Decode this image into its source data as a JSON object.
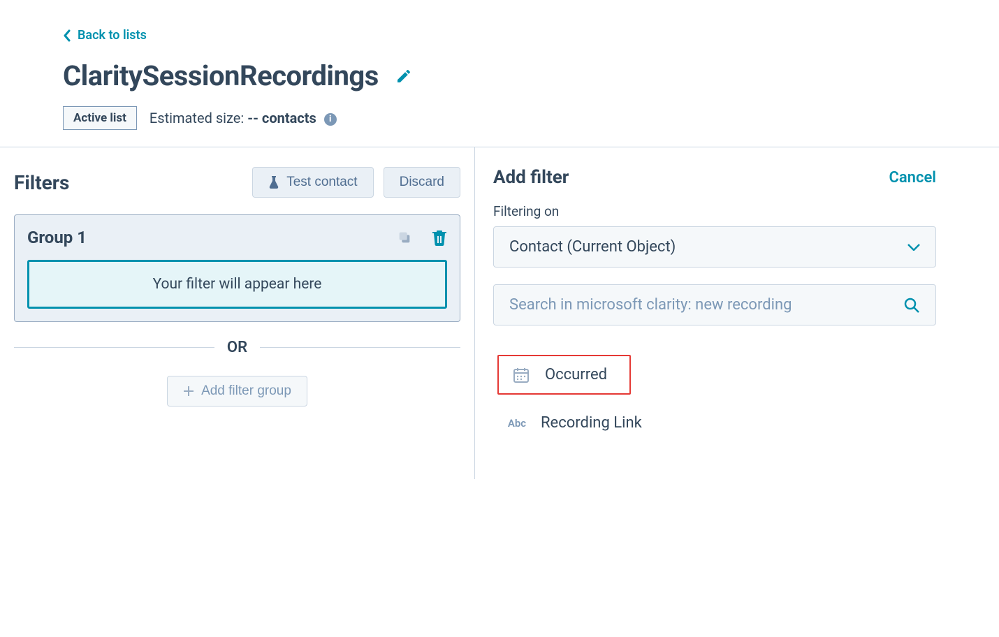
{
  "header": {
    "back_label": "Back to lists",
    "title": "ClaritySessionRecordings",
    "badge_label": "Active list",
    "estimated_prefix": "Estimated size: ",
    "estimated_value": "-- contacts"
  },
  "filters": {
    "title": "Filters",
    "test_button": "Test contact",
    "discard_button": "Discard",
    "group_title": "Group 1",
    "placeholder": "Your filter will appear here",
    "or_label": "OR",
    "add_group_label": "Add filter group"
  },
  "add_filter": {
    "title": "Add filter",
    "cancel": "Cancel",
    "filtering_on_label": "Filtering on",
    "object_select": "Contact (Current Object)",
    "search_placeholder": "Search in microsoft clarity: new recording",
    "options": [
      {
        "type": "date",
        "label": "Occurred"
      },
      {
        "type": "text",
        "label": "Recording Link"
      }
    ]
  }
}
